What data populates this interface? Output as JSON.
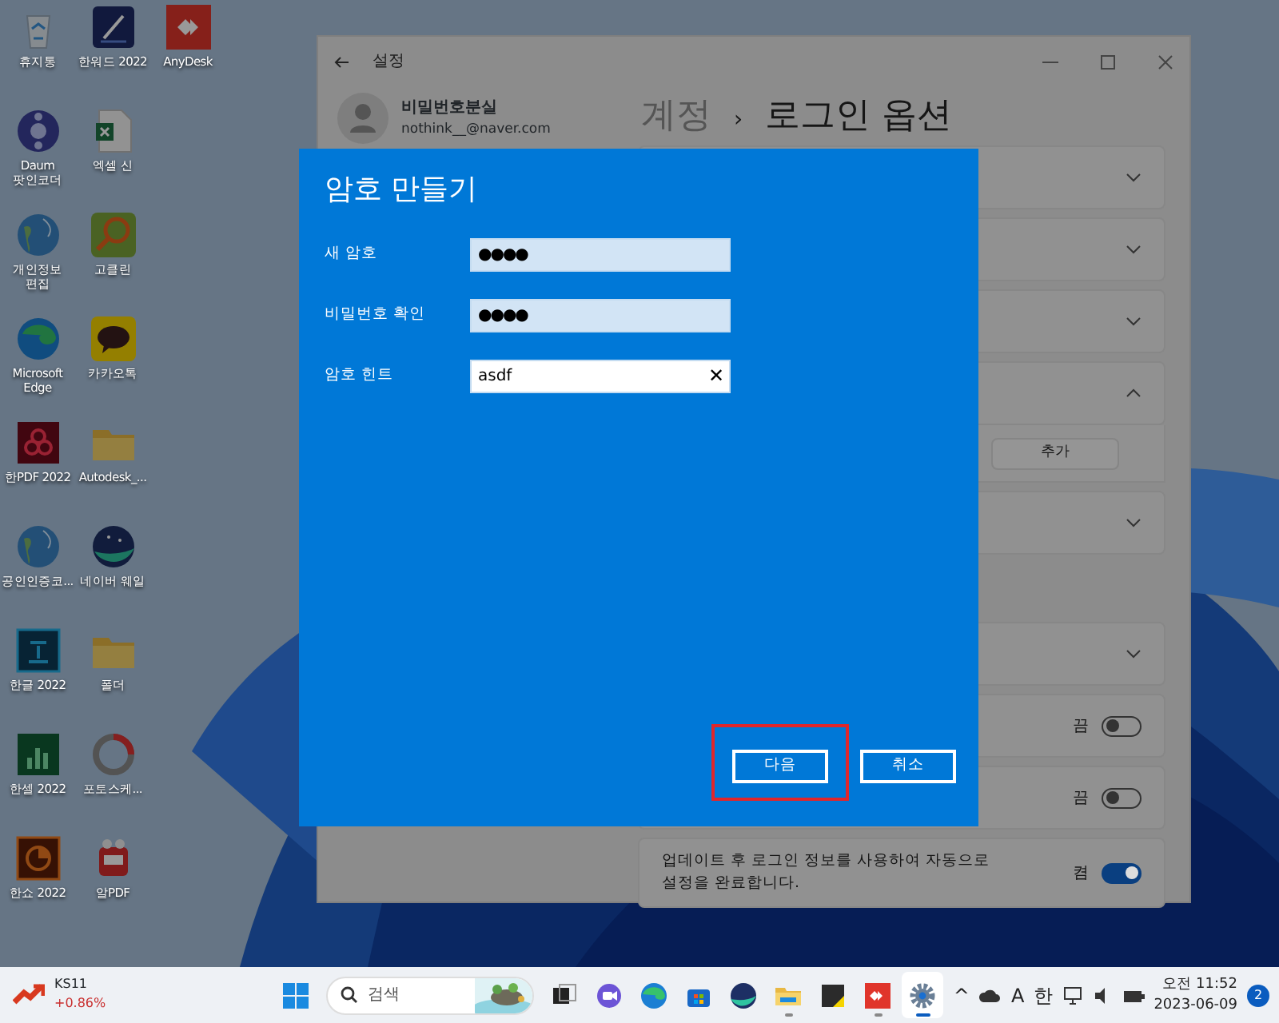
{
  "desktop_icon_rows": [
    [
      {
        "label": "휴지통",
        "kind": "recycle"
      },
      {
        "label": "한워드 2022",
        "kind": "pen"
      },
      {
        "label": "AnyDesk",
        "kind": "remote"
      }
    ],
    [
      {
        "label": "Daum 팟인코더",
        "kind": "reel"
      },
      {
        "label": "엑셀 신",
        "kind": "sheet"
      }
    ],
    [
      {
        "label": "개인정보 편집",
        "kind": "globe"
      },
      {
        "label": "고클린",
        "kind": "magnifier"
      }
    ],
    [
      {
        "label": "Microsoft Edge",
        "kind": "edge"
      },
      {
        "label": "카카오톡",
        "kind": "talk"
      }
    ],
    [
      {
        "label": "한PDF 2022",
        "kind": "acro"
      },
      {
        "label": "Autodesk_...",
        "kind": "folder"
      }
    ],
    [
      {
        "label": "공인인증코...",
        "kind": "globe"
      },
      {
        "label": "네이버 웨일",
        "kind": "whale"
      }
    ],
    [
      {
        "label": "한글 2022",
        "kind": "hangul"
      },
      {
        "label": "폴더",
        "kind": "folder"
      }
    ],
    [
      {
        "label": "한셀 2022",
        "kind": "chart"
      },
      {
        "label": "포토스케...",
        "kind": "ring"
      }
    ],
    [
      {
        "label": "한쇼 2022",
        "kind": "show"
      },
      {
        "label": "알PDF",
        "kind": "pdf"
      }
    ]
  ],
  "settings_window": {
    "title": "설정",
    "account": {
      "name": "비밀번호분실",
      "email": "nothink__@naver.com"
    },
    "breadcrumb": {
      "parent": "계정",
      "separator": "›",
      "current": "로그인 옵션"
    },
    "groups": [
      [
        {
          "kind": "expander",
          "expanded": false
        },
        {
          "kind": "expander",
          "expanded": false
        },
        {
          "kind": "expander",
          "expanded": false
        },
        {
          "kind": "expander",
          "expanded": true,
          "button": "추가"
        },
        {
          "kind": "expander",
          "expanded": false
        }
      ],
      [
        {
          "kind": "expander",
          "expanded": false
        },
        {
          "kind": "toggle",
          "state_label": "끔",
          "on": false
        },
        {
          "kind": "toggle",
          "state_label": "끔",
          "on": false
        },
        {
          "kind": "toggle",
          "text": "업데이트 후 로그인 정보를 사용하여 자동으로 설정을 완료합니다.",
          "state_label": "켬",
          "on": true
        }
      ]
    ]
  },
  "dialog": {
    "title": "암호 만들기",
    "fields": [
      {
        "label": "새 암호",
        "value": "●●●●",
        "kind": "password"
      },
      {
        "label": "비밀번호 확인",
        "value": "●●●●",
        "kind": "password"
      },
      {
        "label": "암호 힌트",
        "value": "asdf",
        "kind": "text",
        "clear_button": "✕"
      }
    ],
    "buttons": [
      {
        "label": "다음",
        "highlighted": true
      },
      {
        "label": "취소",
        "highlighted": false
      }
    ]
  },
  "taskbar": {
    "widget": {
      "name": "KS11",
      "change": "+0.86%"
    },
    "search": {
      "placeholder": "검색"
    },
    "apps": [
      {
        "kind": "task-view",
        "open": false,
        "selected": false
      },
      {
        "kind": "chat",
        "open": false,
        "selected": false
      },
      {
        "kind": "edge",
        "open": false,
        "selected": false
      },
      {
        "kind": "store",
        "open": false,
        "selected": false
      },
      {
        "kind": "whale",
        "open": false,
        "selected": false
      },
      {
        "kind": "folder",
        "open": true,
        "selected": false
      },
      {
        "kind": "note",
        "open": false,
        "selected": false
      },
      {
        "kind": "remote",
        "open": true,
        "selected": false
      },
      {
        "kind": "settings",
        "open": true,
        "selected": true
      }
    ],
    "tray": {
      "overflow": "^",
      "input_mode": "A",
      "ime": "한",
      "time": "오전 11:52",
      "date": "2023-06-09",
      "notifications": "2"
    }
  }
}
